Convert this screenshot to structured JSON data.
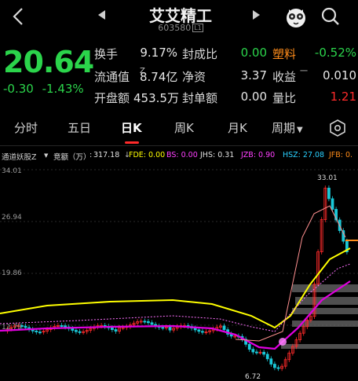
{
  "header": {
    "title": "艾艾精工",
    "code": "603580",
    "code_badge": "L1"
  },
  "quote": {
    "price": "20.64",
    "change": "-0.30",
    "change_pct": "-1.43%",
    "fields": {
      "turnover_label": "换手",
      "turnover_value": "9.17%",
      "seal_ratio_label": "封成比",
      "seal_ratio_value": "0.00",
      "sector_name": "塑料",
      "sector_change": "-0.52%",
      "float_cap_label": "流通值",
      "float_cap_sup": "Z",
      "float_cap_value": "8.74亿",
      "net_asset_label": "净资",
      "net_asset_value": "3.37",
      "earnings_label": "收益",
      "earnings_sup": "一",
      "earnings_value": "0.010",
      "open_amount_label": "开盘额",
      "open_amount_value": "453.5万",
      "seal_amount_label": "封单额",
      "seal_amount_value": "0.00",
      "volume_ratio_label": "量比",
      "volume_ratio_value": "1.21"
    }
  },
  "tabs": [
    {
      "label": "分时"
    },
    {
      "label": "五日"
    },
    {
      "label": "日K"
    },
    {
      "label": "周K"
    },
    {
      "label": "月K"
    },
    {
      "label": "周期"
    }
  ],
  "active_tab": "日K",
  "indicators": {
    "name": "通道妖股Z",
    "bid_label": "竞额（万）",
    "bid_value": "317.18",
    "fde": "FDE: 0.00",
    "bs": "BS: 0.00",
    "jhs": "JHS: 0.31",
    "jzb": "JZB: 0.90",
    "hsz": "HSZ: 27.08",
    "jfb": "JFB: 0."
  },
  "chart_data": {
    "type": "candlestick",
    "y_ticks": [
      "34.01",
      "26.94",
      "19.86",
      "12.79"
    ],
    "annotations": {
      "high": "33.01",
      "low": "6.72"
    }
  },
  "colors": {
    "up": "#ff2a2a",
    "down": "#19c8d8",
    "ma_yellow": "#ffff00",
    "ma_magenta": "#e000e0",
    "accent_red": "#ff2a2a",
    "price_green": "#2bd44b"
  }
}
